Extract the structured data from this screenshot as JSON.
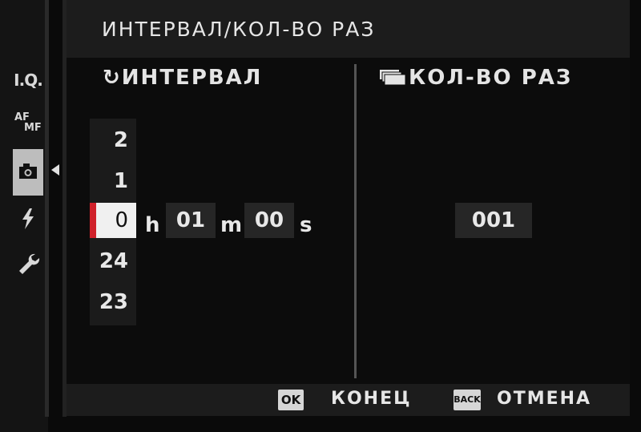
{
  "header": {
    "title": "ИНТЕРВАЛ/КОЛ-ВО РАЗ"
  },
  "sidebar": {
    "iq_label": "I.Q.",
    "af_label": "AF",
    "mf_label": "MF",
    "icons": [
      "camera-icon",
      "flash-icon",
      "wrench-icon"
    ]
  },
  "interval": {
    "title_icon": "↻",
    "title": "ИНТЕРВАЛ",
    "hour_drum": {
      "above": [
        "2",
        "1"
      ],
      "selected": "0",
      "below": [
        "24",
        "23"
      ]
    },
    "hour_unit": "h",
    "minutes": "01",
    "minutes_unit": "m",
    "seconds": "00",
    "seconds_unit": "s"
  },
  "count": {
    "title": "КОЛ-ВО РАЗ",
    "value": "001"
  },
  "footer": {
    "ok_key": "OK",
    "ok_label": "КОНЕЦ",
    "back_key": "BACK",
    "back_label": "ОТМЕНА"
  },
  "colors": {
    "selection_marker": "#d0202a",
    "background": "#0a0a0a"
  }
}
